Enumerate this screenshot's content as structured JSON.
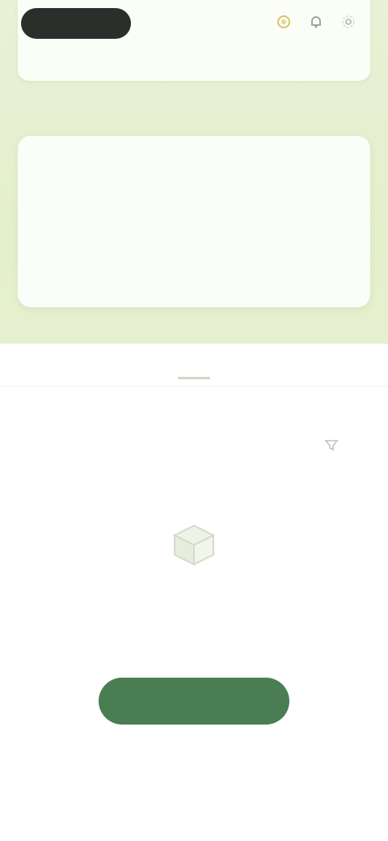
{
  "header": {
    "logo_text": "",
    "icons": [
      "coin-icon",
      "notification-icon",
      "settings-icon"
    ]
  },
  "stats": {
    "title": "",
    "cells": [
      {
        "value": "",
        "label": ""
      },
      {
        "value": "",
        "label": ""
      },
      {
        "value": "",
        "label": ""
      },
      {
        "value": "",
        "label": ""
      }
    ]
  },
  "tabs": [
    {
      "label": ""
    },
    {
      "label": ""
    },
    {
      "label": ""
    }
  ],
  "section": {
    "title": "",
    "action_icon": "filter-icon"
  },
  "empty_state": {
    "icon": "empty-box-icon",
    "title": "",
    "description": ""
  },
  "primary_button": {
    "label": ""
  },
  "colors": {
    "background_top": "#e6f0d0",
    "card": "#fbfdf8",
    "logo_pill": "#2b2f2b",
    "primary": "#4a7d52",
    "muted_text": "#9da298"
  }
}
